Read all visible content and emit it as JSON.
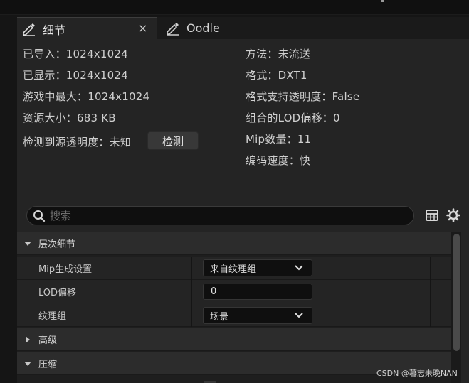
{
  "tabs": [
    {
      "label": "细节",
      "close": "×",
      "active": true
    },
    {
      "label": "Oodle",
      "active": false
    }
  ],
  "info_left": [
    "已导入：1024x1024",
    "已显示：1024x1024",
    "游戏中最大：1024x1024",
    "资源大小：683 KB",
    "检测到源透明度：未知"
  ],
  "detect_button": "检测",
  "info_right": [
    "方法：未流送",
    "格式：DXT1",
    "格式支持透明度：False",
    "组合的LOD偏移：0",
    "Mip数量：11",
    "编码速度：快"
  ],
  "search": {
    "placeholder": "搜索",
    "icon": "search-icon"
  },
  "toolbar_icons": [
    "table-icon",
    "gear-icon"
  ],
  "categories": {
    "lod": "层次细节",
    "advanced": "高级",
    "compression": "压缩"
  },
  "properties": {
    "mip_gen": {
      "label": "Mip生成设置",
      "value": "来自纹理组"
    },
    "lod_bias": {
      "label": "LOD偏移",
      "value": "0"
    },
    "texture_group": {
      "label": "纹理组",
      "value": "场景"
    }
  },
  "watermark": "CSDN @暮志未晚NAN",
  "colors": {
    "panel": "#242424",
    "category": "#2c2c2c",
    "field": "#0f0f0f",
    "text": "#c8c8c8"
  }
}
